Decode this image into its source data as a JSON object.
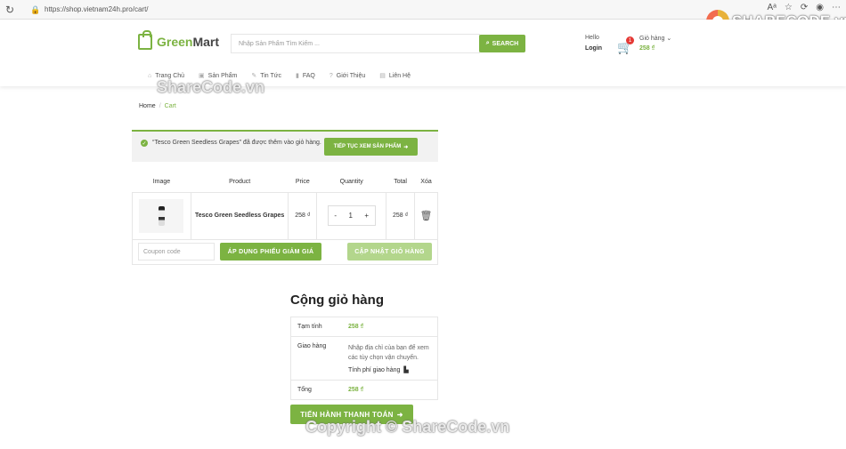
{
  "browser": {
    "url": "https://shop.vietnam24h.pro/cart/",
    "brand": "SHARECODE.vn"
  },
  "header": {
    "logo_green": "Green",
    "logo_dark": "Mart",
    "search_placeholder": "Nhập Sản Phẩm Tìm Kiếm ...",
    "search_button": "SEARCH",
    "hello": "Hello",
    "login": "Login",
    "cart_count": "1",
    "cart_label": "Giỏ hàng",
    "cart_total": "258 ₫"
  },
  "nav": {
    "items": [
      {
        "label": "Trang Chủ"
      },
      {
        "label": "Sản Phẩm"
      },
      {
        "label": "Tin Tức"
      },
      {
        "label": "FAQ"
      },
      {
        "label": "Giới Thiệu"
      },
      {
        "label": "Liên Hệ"
      }
    ]
  },
  "breadcrumb": {
    "home": "Home",
    "sep": "/",
    "current": "Cart"
  },
  "notice": {
    "message": "“Tesco Green Seedless Grapes” đã được thêm vào giỏ hàng.",
    "continue_button": "TIẾP TỤC XEM SẢN PHẨM"
  },
  "cart_table": {
    "headers": [
      "Image",
      "Product",
      "Price",
      "Quantity",
      "Total",
      "Xóa"
    ],
    "rows": [
      {
        "product": "Tesco Green Seedless Grapes",
        "price": "258 ₫",
        "quantity": "1",
        "total": "258 ₫"
      }
    ],
    "minus": "-",
    "plus": "+"
  },
  "coupon": {
    "placeholder": "Coupon code",
    "apply_button": "ÁP DỤNG PHIẾU GIẢM GIÁ",
    "update_button": "CẬP NHẬT GIỎ HÀNG"
  },
  "totals": {
    "title": "Cộng giỏ hàng",
    "subtotal_label": "Tạm tính",
    "subtotal_value": "258 ₫",
    "shipping_label": "Giao hàng",
    "shipping_text": "Nhập địa chỉ của bạn để xem các tùy chọn vận chuyển.",
    "shipping_calc": "Tính phí giao hàng",
    "total_label": "Tổng",
    "total_value": "258 ₫",
    "checkout_button": "TIẾN HÀNH THANH TOÁN"
  },
  "watermarks": {
    "top": "ShareCode.vn",
    "bottom": "Copyright © ShareCode.vn"
  },
  "colors": {
    "accent": "#7cb342",
    "accent_light": "#b3d68c",
    "badge": "#e53935"
  }
}
